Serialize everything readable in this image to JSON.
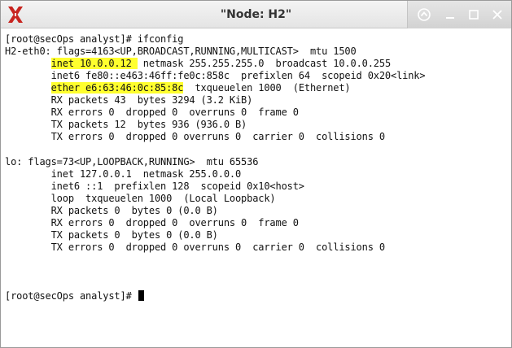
{
  "window": {
    "title": "\"Node: H2\"",
    "app_icon": "x-window-system-icon"
  },
  "controls": {
    "shade_icon": "shade-up-icon",
    "minimize_icon": "minimize-icon",
    "maximize_icon": "maximize-icon",
    "close_icon": "close-icon"
  },
  "colors": {
    "highlight": "#ffff2e",
    "app_icon_red": "#c8241f",
    "terminal_text": "#111111"
  },
  "terminal": {
    "l1": "[root@secOps analyst]# ifconfig",
    "l2": "H2-eth0: flags=4163<UP,BROADCAST,RUNNING,MULTICAST>  mtu 1500",
    "l3_indent": "        ",
    "l3_hl": "inet 10.0.0.12 ",
    "l3_rest": " netmask 255.255.255.0  broadcast 10.0.0.255",
    "l4": "        inet6 fe80::e463:46ff:fe0c:858c  prefixlen 64  scopeid 0x20<link>",
    "l5_indent": "        ",
    "l5_hl": "ether e6:63:46:0c:85:8c",
    "l5_rest": "  txqueuelen 1000  (Ethernet)",
    "l6": "        RX packets 43  bytes 3294 (3.2 KiB)",
    "l7": "        RX errors 0  dropped 0  overruns 0  frame 0",
    "l8": "        TX packets 12  bytes 936 (936.0 B)",
    "l9": "        TX errors 0  dropped 0 overruns 0  carrier 0  collisions 0",
    "l10": "",
    "l11": "lo: flags=73<UP,LOOPBACK,RUNNING>  mtu 65536",
    "l12": "        inet 127.0.0.1  netmask 255.0.0.0",
    "l13": "        inet6 ::1  prefixlen 128  scopeid 0x10<host>",
    "l14": "        loop  txqueuelen 1000  (Local Loopback)",
    "l15": "        RX packets 0  bytes 0 (0.0 B)",
    "l16": "        RX errors 0  dropped 0  overruns 0  frame 0",
    "l17": "        TX packets 0  bytes 0 (0.0 B)",
    "l18": "        TX errors 0  dropped 0 overruns 0  carrier 0  collisions 0",
    "l19": "",
    "l20": "[root@secOps analyst]# "
  }
}
